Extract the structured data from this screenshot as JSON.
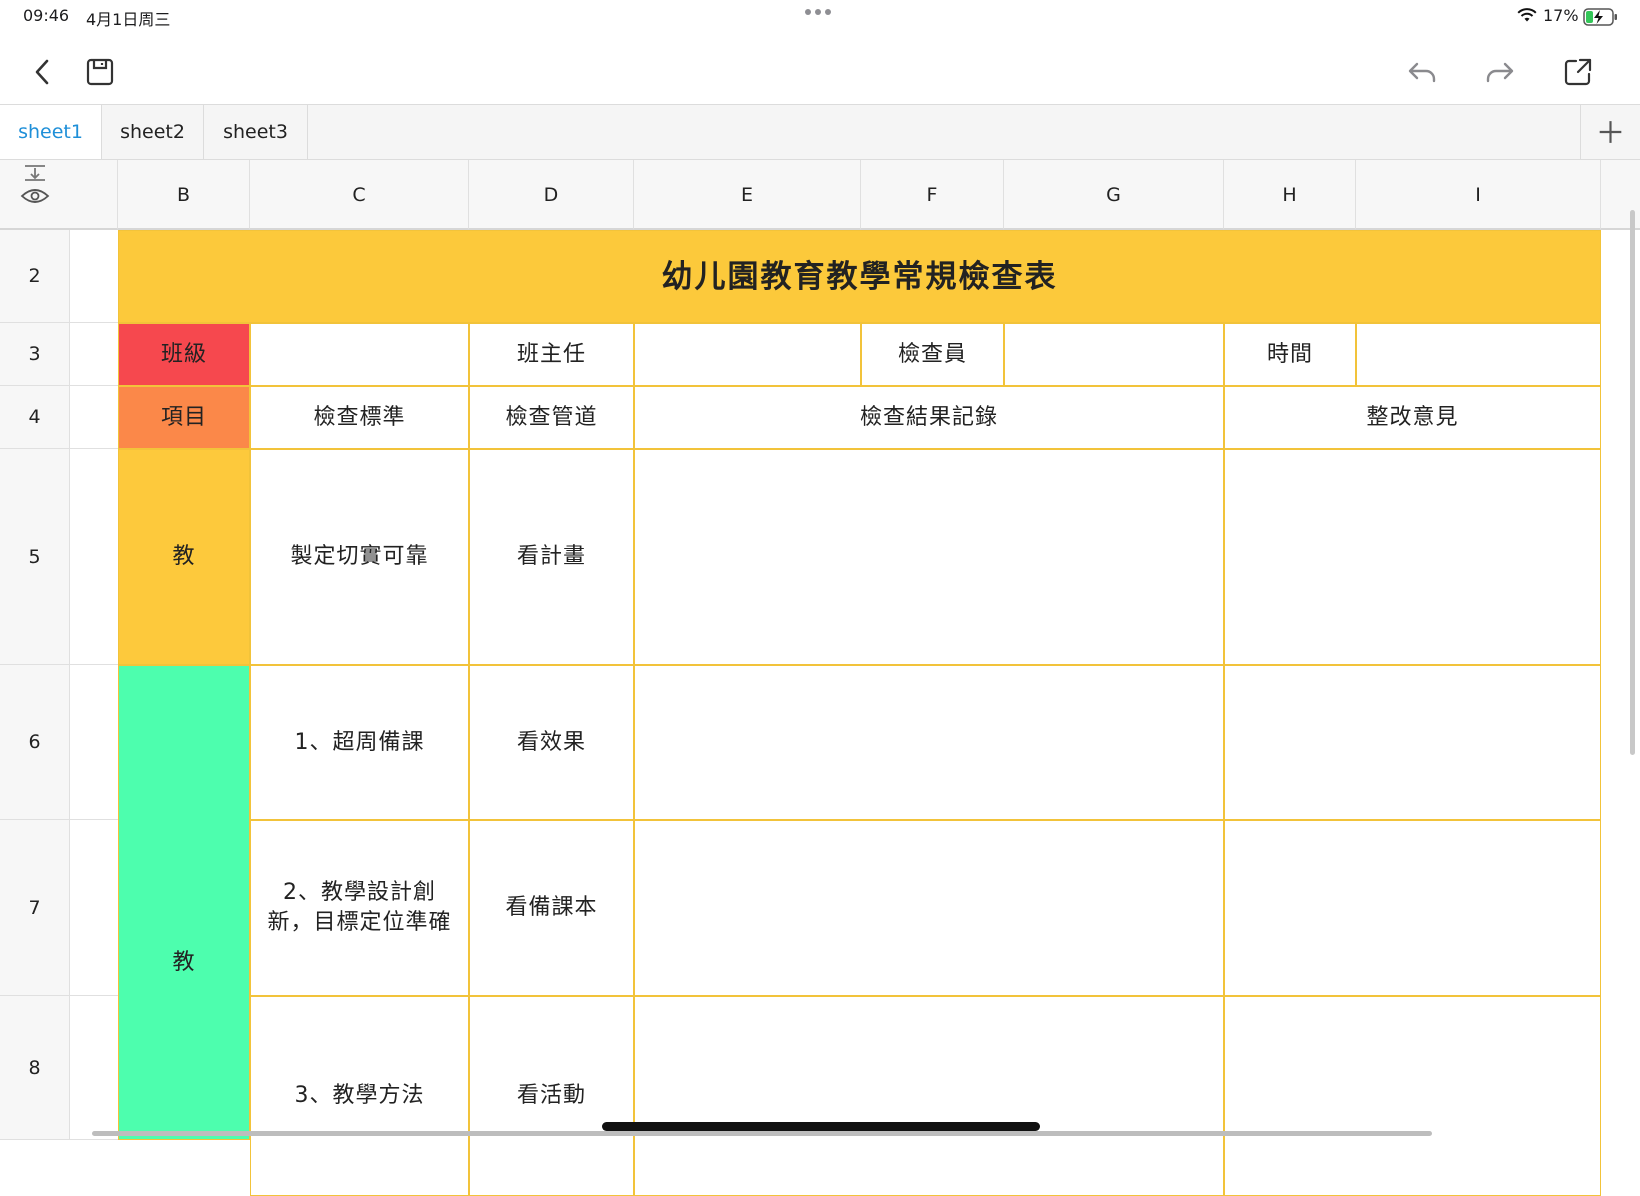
{
  "status_bar": {
    "time": "09:46",
    "date": "4月1日周三",
    "battery_percent": "17%"
  },
  "toolbar": {
    "back_icon": "chevron-left-icon",
    "save_icon": "save-icon",
    "undo_icon": "undo-icon",
    "redo_icon": "redo-icon",
    "share_icon": "share-icon"
  },
  "tabs": [
    {
      "label": "sheet1",
      "active": true
    },
    {
      "label": "sheet2",
      "active": false
    },
    {
      "label": "sheet3",
      "active": false
    }
  ],
  "columns": [
    "B",
    "C",
    "D",
    "E",
    "F",
    "G",
    "H",
    "I"
  ],
  "rows": [
    "2",
    "3",
    "4",
    "5",
    "6",
    "7",
    "8"
  ],
  "sheet": {
    "title": "幼儿園教育教學常規檢查表",
    "row3": {
      "class_label": "班級",
      "head_teacher_label": "班主任",
      "inspector_label": "檢查員",
      "time_label": "時間"
    },
    "row4": {
      "item": "項目",
      "standard": "檢查標準",
      "channel": "檢查管道",
      "result": "檢查結果記錄",
      "advice": "整改意見"
    },
    "row5": {
      "item": "教",
      "standard": "製定切實可靠",
      "channel": "看計畫"
    },
    "row6": {
      "standard": "1、超周備課",
      "channel": "看效果"
    },
    "row7": {
      "standard": "2、教學設計創新，目標定位準確",
      "channel": "看備課本"
    },
    "row8": {
      "standard": "3、教學方法",
      "channel": "看活動"
    },
    "merged_item_6_8": "教"
  },
  "colors": {
    "title_bg": "#fcc93b",
    "class_bg": "#f6484e",
    "item_bg": "#fb8849",
    "row5_item_bg": "#fdc93c",
    "rows6to8_item_bg": "#4dfeae",
    "active_tab": "#1e8fd8",
    "cell_border": "#f2c33a"
  }
}
